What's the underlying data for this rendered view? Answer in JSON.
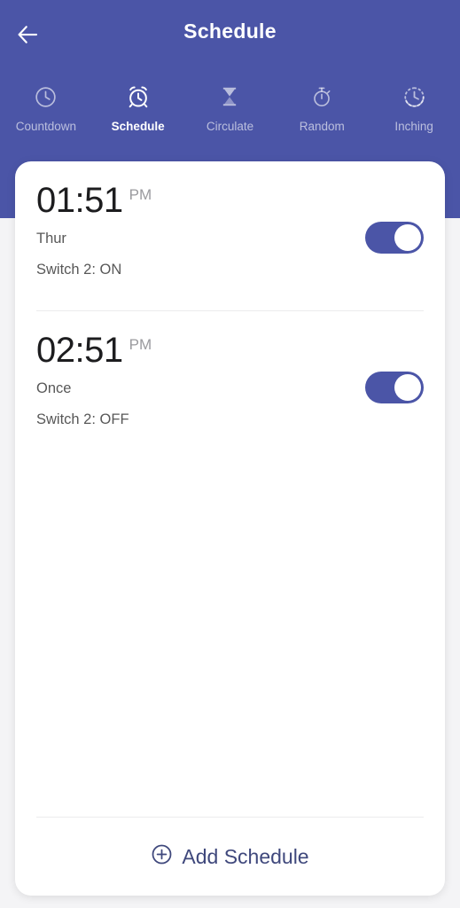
{
  "header": {
    "title": "Schedule",
    "back_icon": "arrow-left-icon",
    "background_color": "#4b55a7"
  },
  "tabs": [
    {
      "label": "Countdown",
      "icon": "clock-icon",
      "active": false
    },
    {
      "label": "Schedule",
      "icon": "alarm-clock-icon",
      "active": true
    },
    {
      "label": "Circulate",
      "icon": "hourglass-icon",
      "active": false
    },
    {
      "label": "Random",
      "icon": "stopwatch-icon",
      "active": false
    },
    {
      "label": "Inching",
      "icon": "dashed-clock-icon",
      "active": false
    }
  ],
  "schedules": [
    {
      "time": "01:51",
      "meridiem": "PM",
      "repeat": "Thur",
      "action": "Switch 2: ON",
      "enabled": true,
      "toggle_name": "schedule-toggle-1"
    },
    {
      "time": "02:51",
      "meridiem": "PM",
      "repeat": "Once",
      "action": "Switch 2: OFF",
      "enabled": true,
      "toggle_name": "schedule-toggle-2"
    }
  ],
  "footer": {
    "add_label": "Add Schedule",
    "add_icon": "plus-circle-icon"
  },
  "colors": {
    "accent": "#4b55a7",
    "card": "#ffffff",
    "page_background": "#f4f4f6",
    "primary_text": "#1d1d1f",
    "secondary_text": "#585858",
    "muted_text": "#9a9a9e",
    "footer_text": "#3f487c"
  }
}
